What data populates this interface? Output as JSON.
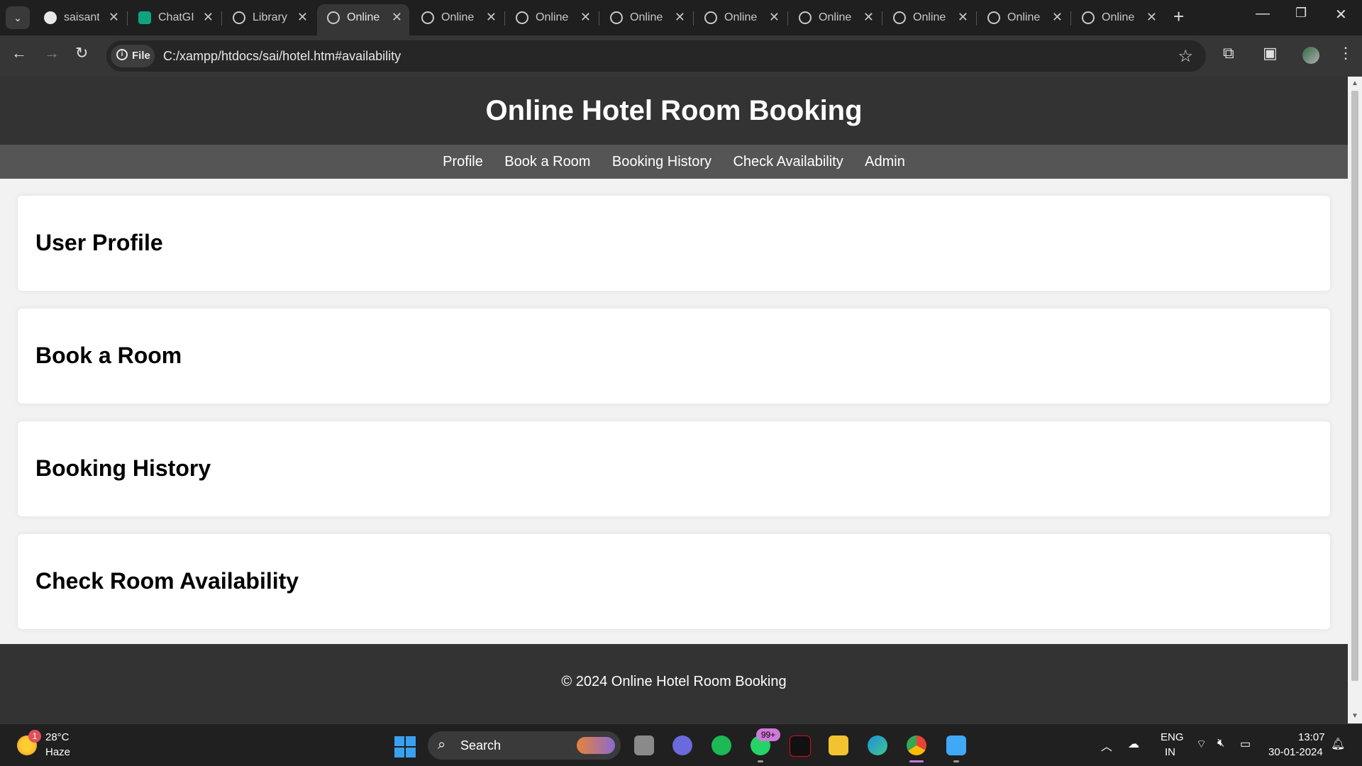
{
  "browser": {
    "tabs": [
      {
        "title": "saisant",
        "icon": "github-icon"
      },
      {
        "title": "ChatGI",
        "icon": "chatgpt-icon"
      },
      {
        "title": "Library",
        "icon": "globe-icon"
      },
      {
        "title": "Online",
        "icon": "globe-icon",
        "active": true
      },
      {
        "title": "Online",
        "icon": "globe-icon"
      },
      {
        "title": "Online",
        "icon": "globe-icon"
      },
      {
        "title": "Online",
        "icon": "globe-icon"
      },
      {
        "title": "Online",
        "icon": "globe-icon"
      },
      {
        "title": "Online",
        "icon": "globe-icon"
      },
      {
        "title": "Online",
        "icon": "globe-icon"
      },
      {
        "title": "Online",
        "icon": "globe-icon"
      },
      {
        "title": "Online",
        "icon": "globe-icon"
      }
    ],
    "site_chip": "File",
    "url": "C:/xampp/htdocs/sai/hotel.htm#availability"
  },
  "page": {
    "title": "Online Hotel Room Booking",
    "nav": [
      "Profile",
      "Book a Room",
      "Booking History",
      "Check Availability",
      "Admin"
    ],
    "sections": [
      "User Profile",
      "Book a Room",
      "Booking History",
      "Check Room Availability"
    ],
    "footer": "© 2024 Online Hotel Room Booking"
  },
  "taskbar": {
    "weather": {
      "temp": "28°C",
      "condition": "Haze",
      "badge": "1"
    },
    "search_label": "Search",
    "whatsapp_badge": "99+",
    "lang_line1": "ENG",
    "lang_line2": "IN",
    "time": "13:07",
    "date": "30-01-2024"
  }
}
